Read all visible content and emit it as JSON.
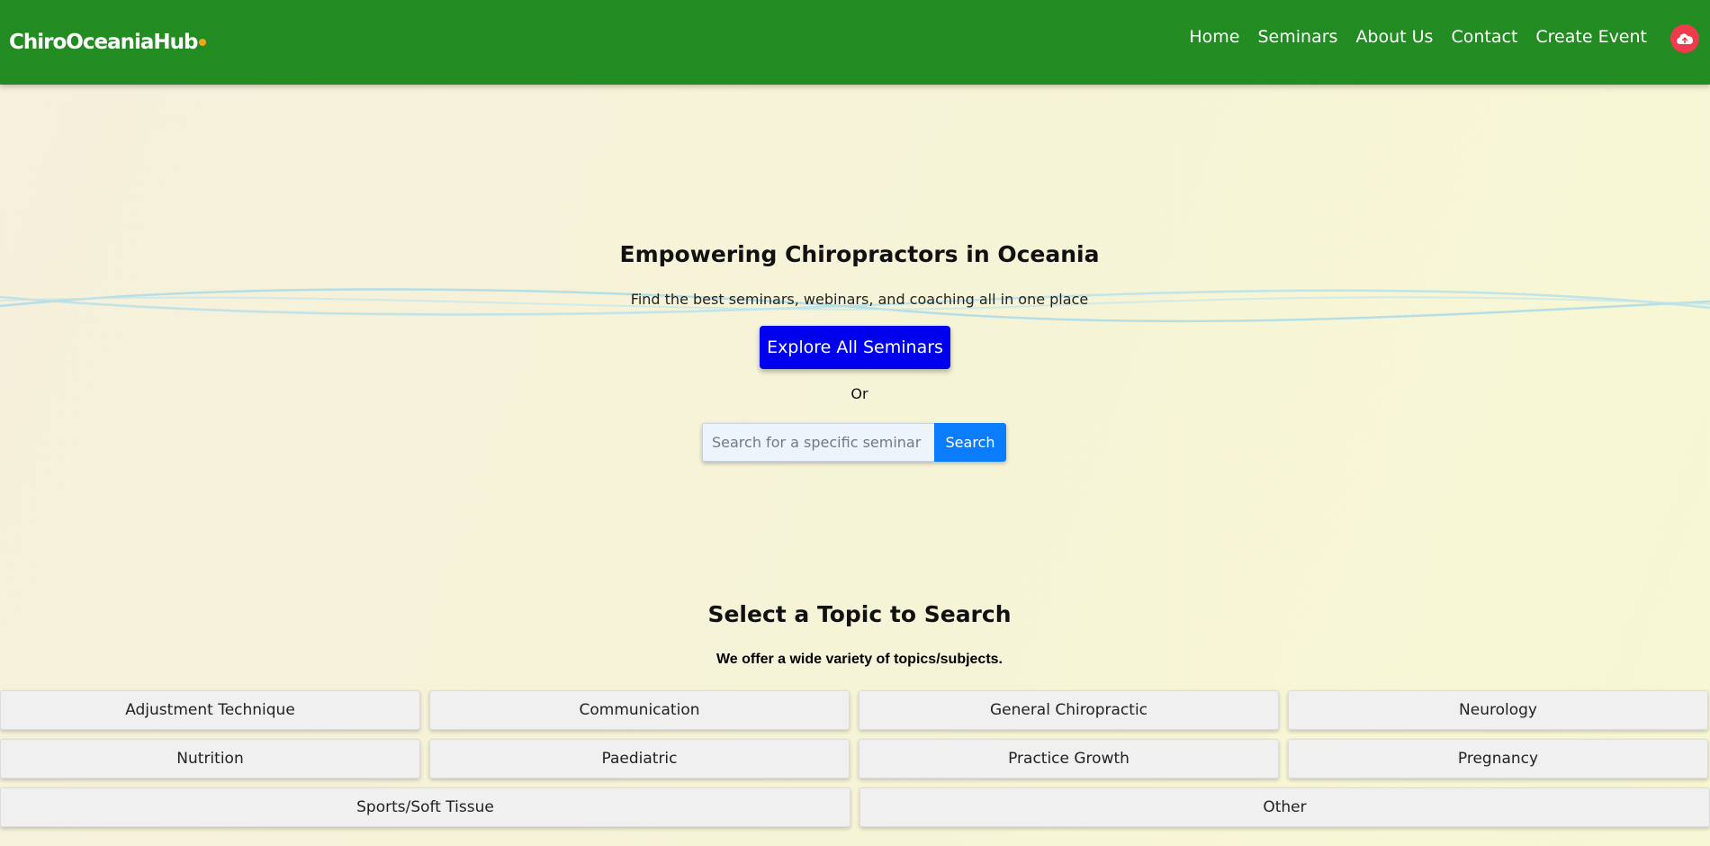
{
  "navbar": {
    "brand": "ChiroOceaniaHub",
    "links": [
      "Home",
      "Seminars",
      "About Us",
      "Contact",
      "Create Event"
    ],
    "upload_icon": "cloud-upload-icon",
    "colors": {
      "background": "#228b22",
      "brand_dot": "#f4a41b",
      "upload_button": "#ef3b4e"
    }
  },
  "hero": {
    "title": "Empowering Chiropractors in Oceania",
    "subtitle": "Find the best seminars, webinars, and coaching all in one place",
    "explore_label": "Explore All Seminars",
    "or_label": "Or",
    "search": {
      "value": "",
      "placeholder": "Search for a specific seminar",
      "button_label": "Search"
    },
    "colors": {
      "explore_button": "#0000ee",
      "search_button": "#0a7dff"
    }
  },
  "topics": {
    "title": "Select a Topic to Search",
    "subtitle": "We offer a wide variety of topics/subjects.",
    "rows": [
      [
        "Adjustment Technique",
        "Communication",
        "General Chiropractic",
        "Neurology"
      ],
      [
        "Nutrition",
        "Paediatric",
        "Practice Growth",
        "Pregnancy"
      ],
      [
        "Sports/Soft Tissue",
        "Other"
      ]
    ]
  }
}
